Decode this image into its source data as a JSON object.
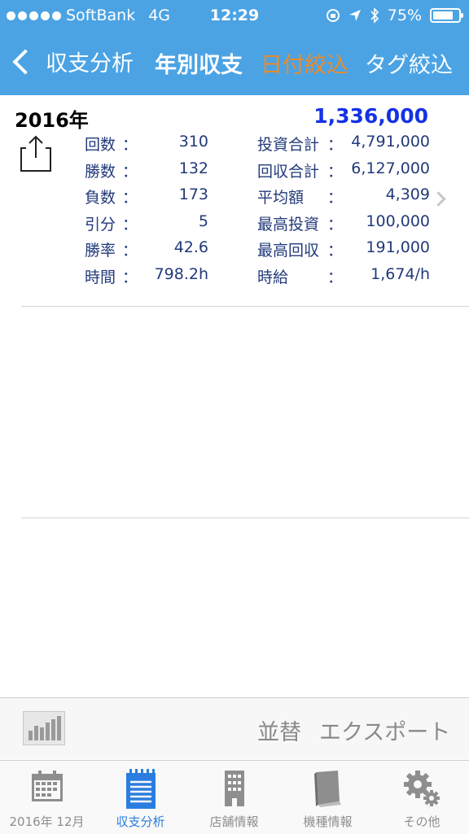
{
  "status": {
    "carrier": "SoftBank",
    "network": "4G",
    "time": "12:29",
    "battery": "75%",
    "battery_level": 0.75
  },
  "nav": {
    "back_label": "収支分析",
    "title": "年別収支",
    "date_filter": "日付絞込",
    "tag_filter": "タグ絞込"
  },
  "summary": {
    "year": "2016年",
    "total": "1,336,000",
    "left": [
      {
        "label": "回数",
        "value": "310"
      },
      {
        "label": "勝数",
        "value": "132"
      },
      {
        "label": "負数",
        "value": "173"
      },
      {
        "label": "引分",
        "value": "5"
      },
      {
        "label": "勝率",
        "value": "42.6"
      },
      {
        "label": "時間",
        "value": "798.2h"
      }
    ],
    "right": [
      {
        "label": "投資合計",
        "value": "4,791,000"
      },
      {
        "label": "回収合計",
        "value": "6,127,000"
      },
      {
        "label": "平均額",
        "value": "4,309"
      },
      {
        "label": "最高投資",
        "value": "100,000"
      },
      {
        "label": "最高回収",
        "value": "191,000"
      },
      {
        "label": "時給",
        "value": "1,674/h"
      }
    ],
    "colon": "："
  },
  "toolbar": {
    "sort_label": "並替",
    "export_label": "エクスポート"
  },
  "tabs": [
    {
      "label": "2016年 12月",
      "icon": "calendar-icon",
      "active": false
    },
    {
      "label": "収支分析",
      "icon": "notepad-icon",
      "active": true
    },
    {
      "label": "店舗情報",
      "icon": "building-icon",
      "active": false
    },
    {
      "label": "機種情報",
      "icon": "book-icon",
      "active": false
    },
    {
      "label": "その他",
      "icon": "gears-icon",
      "active": false
    }
  ],
  "colors": {
    "header": "#4ba3e4",
    "accent_orange": "#f08a24",
    "total_blue": "#1432e6",
    "tab_active": "#2b7de0"
  }
}
